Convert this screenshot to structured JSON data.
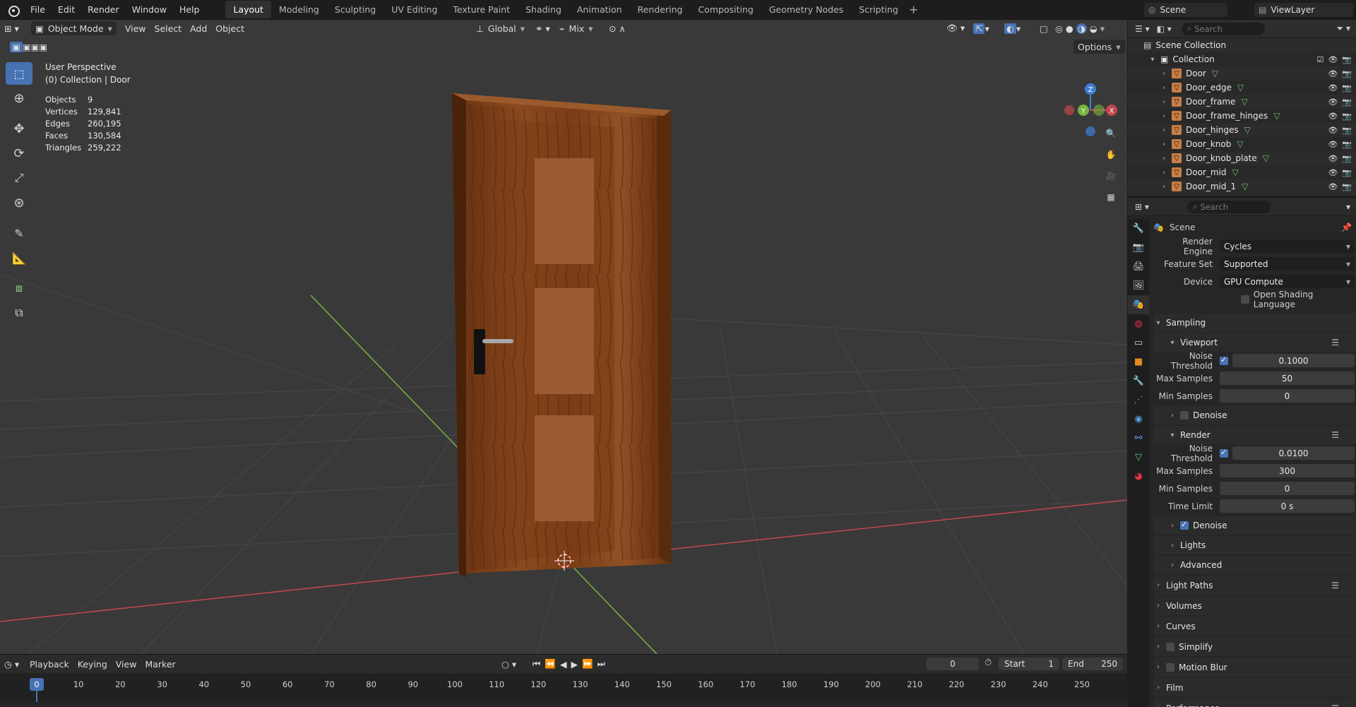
{
  "menu": [
    "File",
    "Edit",
    "Render",
    "Window",
    "Help"
  ],
  "workspaces": [
    "Layout",
    "Modeling",
    "Sculpting",
    "UV Editing",
    "Texture Paint",
    "Shading",
    "Animation",
    "Rendering",
    "Compositing",
    "Geometry Nodes",
    "Scripting"
  ],
  "active_workspace": "Layout",
  "scene_name": "Scene",
  "view_layer": "ViewLayer",
  "viewport_header": {
    "mode": "Object Mode",
    "menus": [
      "View",
      "Select",
      "Add",
      "Object"
    ],
    "transform_orientation": "Global",
    "snap_mode": "Mix",
    "options_label": "Options"
  },
  "viewport_info": {
    "perspective": "User Perspective",
    "collection": "(0) Collection | Door"
  },
  "stats": [
    {
      "label": "Objects",
      "value": "9"
    },
    {
      "label": "Vertices",
      "value": "129,841"
    },
    {
      "label": "Edges",
      "value": "260,195"
    },
    {
      "label": "Faces",
      "value": "130,584"
    },
    {
      "label": "Triangles",
      "value": "259,222"
    }
  ],
  "gizmo": {
    "z": "Z",
    "y": "Y",
    "x": "X"
  },
  "timeline": {
    "menus": [
      "Playback",
      "Keying",
      "View",
      "Marker"
    ],
    "current_frame": "0",
    "start_label": "Start",
    "start": "1",
    "end_label": "End",
    "end": "250",
    "ticks": [
      "0",
      "10",
      "20",
      "30",
      "40",
      "50",
      "60",
      "70",
      "80",
      "90",
      "100",
      "110",
      "120",
      "130",
      "140",
      "150",
      "160",
      "170",
      "180",
      "190",
      "200",
      "210",
      "220",
      "230",
      "240",
      "250"
    ]
  },
  "outliner": {
    "search_placeholder": "Search",
    "scene_collection": "Scene Collection",
    "collection": "Collection",
    "objects": [
      "Door",
      "Door_edge",
      "Door_frame",
      "Door_frame_hinges",
      "Door_hinges",
      "Door_knob",
      "Door_knob_plate",
      "Door_mid",
      "Door_mid_1"
    ]
  },
  "properties": {
    "search_placeholder": "Search",
    "context": "Scene",
    "render_engine_label": "Render Engine",
    "render_engine": "Cycles",
    "feature_set_label": "Feature Set",
    "feature_set": "Supported",
    "device_label": "Device",
    "device": "GPU Compute",
    "osl_label": "Open Shading Language",
    "sampling": "Sampling",
    "viewport": "Viewport",
    "noise_threshold_label": "Noise Threshold",
    "viewport_noise_threshold": "0.1000",
    "max_samples_label": "Max Samples",
    "viewport_max_samples": "50",
    "min_samples_label": "Min Samples",
    "viewport_min_samples": "0",
    "denoise_label": "Denoise",
    "render": "Render",
    "render_noise_threshold": "0.0100",
    "render_max_samples": "300",
    "render_min_samples": "0",
    "time_limit_label": "Time Limit",
    "time_limit": "0 s",
    "lights": "Lights",
    "advanced": "Advanced",
    "sections": [
      "Light Paths",
      "Volumes",
      "Curves",
      "Simplify",
      "Motion Blur",
      "Film",
      "Performance"
    ]
  },
  "colors": {
    "accent": "#4772b3",
    "viewport_bg": "#393939",
    "x_axis": "#c2464f",
    "y_axis": "#7ab241",
    "z_axis": "#3f7fd8",
    "wood": "#7a3e18"
  }
}
